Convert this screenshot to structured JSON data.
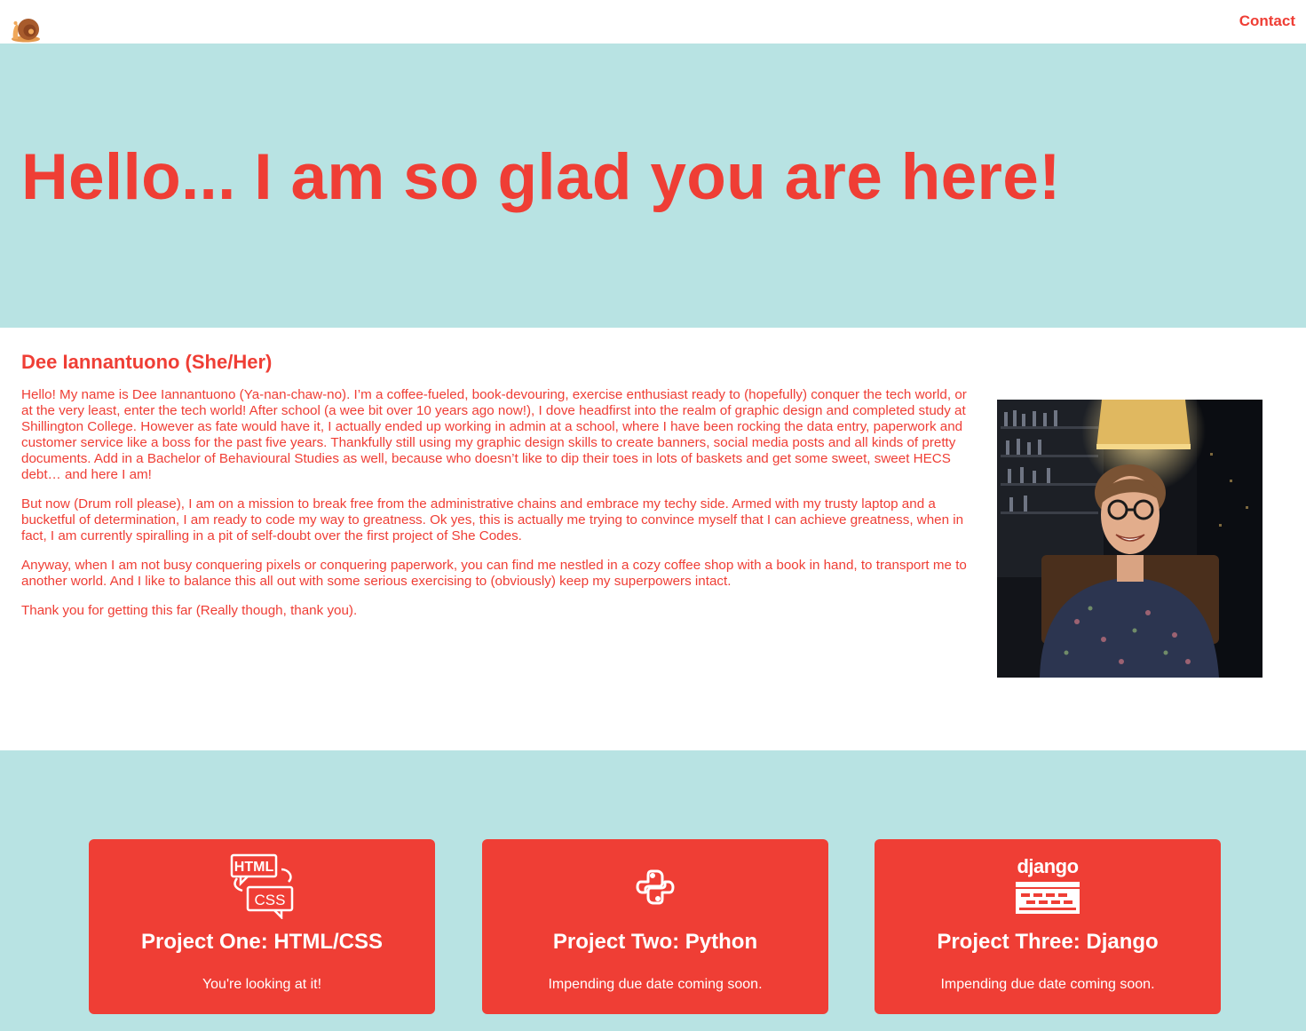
{
  "nav": {
    "logo_icon": "snail-logo-icon",
    "contact_label": "Contact"
  },
  "hero": {
    "title": "Hello... I am so glad you are here!"
  },
  "about": {
    "name": "Dee Iannantuono (She/Her)",
    "paragraphs": [
      "Hello! My name is Dee Iannantuono (Ya-nan-chaw-no). I’m a coffee-fueled, book-devouring, exercise enthusiast ready to (hopefully) conquer the tech world, or at the very least, enter the tech world! After school (a wee bit over 10 years ago now!), I dove headfirst into the realm of graphic design and completed study at Shillington College. However as fate would have it, I actually ended up working in admin at a school, where I have been rocking the data entry, paperwork and customer service like a boss for the past five years. Thankfully still using my graphic design skills to create banners, social media posts and all kinds of pretty documents. Add in a Bachelor of Behavioural Studies as well, because who doesn’t like to dip their toes in lots of baskets and get some sweet, sweet HECS debt… and here I am!",
      "But now (Drum roll please), I am on a mission to break free from the administrative chains and embrace my techy side. Armed with my trusty laptop and a bucketful of determination, I am ready to code my way to greatness. Ok yes, this is actually me trying to convince myself that I can achieve greatness, when in fact, I am currently spiralling in a pit of self-doubt over the first project of She Codes.",
      "Anyway, when I am not busy conquering pixels or conquering paperwork, you can find me nestled in a cozy coffee shop with a book in hand, to transport me to another world. And I like to balance this all out with some serious exercising to (obviously) keep my superpowers intact.",
      "Thank you for getting this far (Really though, thank you)."
    ]
  },
  "projects": [
    {
      "icon": "html-css-icon",
      "title": "Project One: HTML/CSS",
      "description": "You're looking at it!"
    },
    {
      "icon": "python-icon",
      "title": "Project Two: Python",
      "description": "Impending due date coming soon."
    },
    {
      "icon": "django-icon",
      "title": "Project Three: Django",
      "description": "Impending due date coming soon."
    }
  ],
  "colors": {
    "accent": "#ef3e35",
    "teal_background": "#b8e3e3",
    "white": "#ffffff"
  }
}
